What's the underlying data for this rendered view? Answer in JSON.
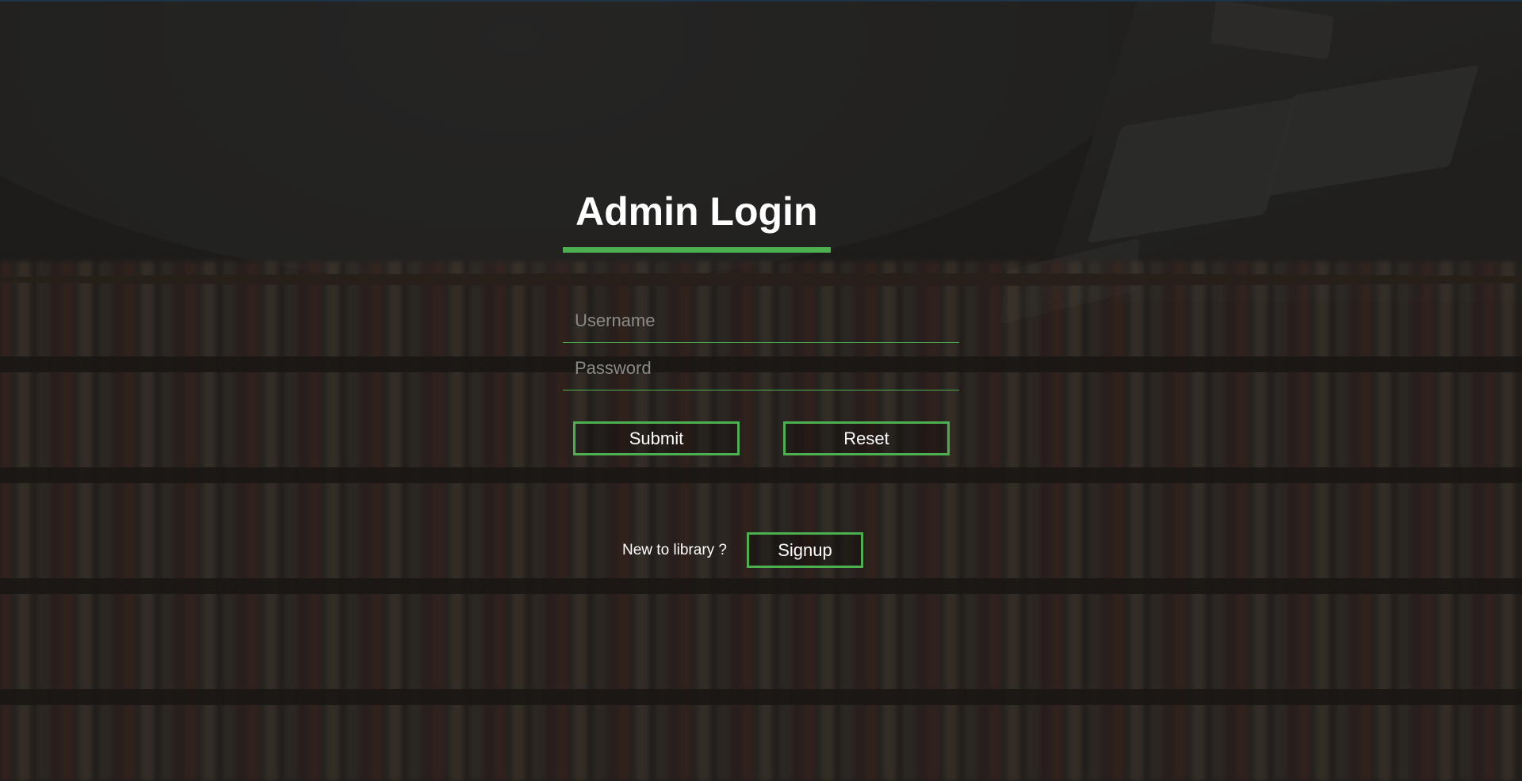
{
  "page": {
    "title": "Admin Login"
  },
  "form": {
    "username": {
      "value": "",
      "placeholder": "Username"
    },
    "password": {
      "value": "",
      "placeholder": "Password"
    },
    "submit_label": "Submit",
    "reset_label": "Reset"
  },
  "signup": {
    "prompt": "New to library ?",
    "button_label": "Signup"
  },
  "colors": {
    "accent": "#4caf50",
    "text": "#ffffff",
    "placeholder": "#8b8b86",
    "overlay": "rgba(20,20,20,0.55)"
  }
}
